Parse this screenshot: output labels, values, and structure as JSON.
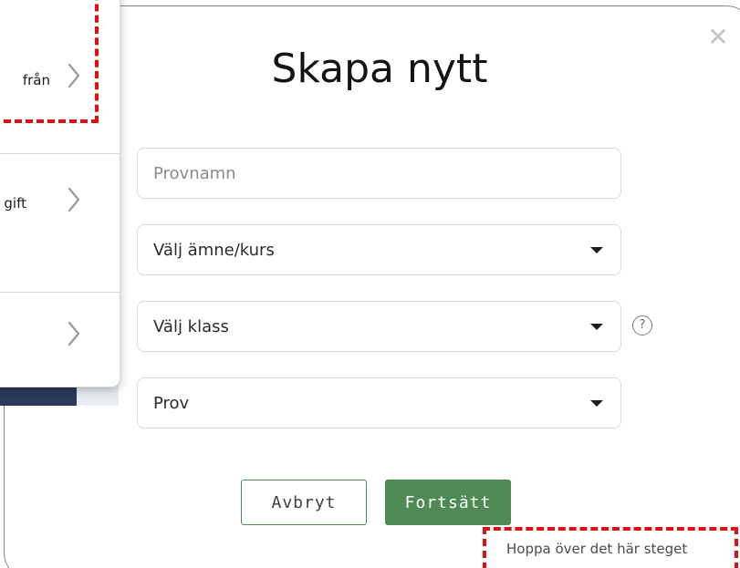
{
  "modal": {
    "title": "Skapa nytt",
    "close_icon": "close-icon",
    "name_input": {
      "placeholder": "Provnamn",
      "value": ""
    },
    "subject_select": {
      "value": "Välj ämne/kurs"
    },
    "class_select": {
      "value": "Välj klass"
    },
    "type_select": {
      "value": "Prov"
    },
    "help_icon": {
      "glyph": "?"
    },
    "cancel_label": "Avbryt",
    "continue_label": "Fortsätt",
    "skip_label": "Hoppa över det här steget"
  },
  "menu": {
    "items": [
      {
        "label": "från",
        "icon": "chevron-right-icon"
      },
      {
        "label": "gift",
        "icon": "chevron-right-icon"
      },
      {
        "label": "",
        "icon": "chevron-right-icon"
      }
    ]
  },
  "colors": {
    "primary_green": "#4e8a54",
    "highlight_red": "#e01010",
    "backdrop_navy": "#2a3a5a"
  }
}
